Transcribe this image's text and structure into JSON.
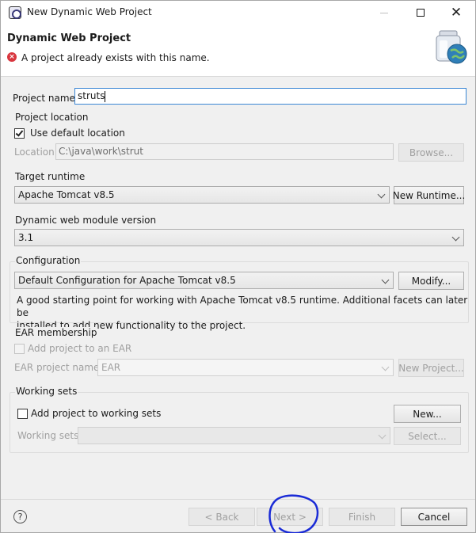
{
  "window": {
    "title": "New Dynamic Web Project",
    "minimize_icon": "minimize-icon",
    "maximize_icon": "maximize-icon",
    "close_glyph": "✕"
  },
  "banner": {
    "title": "Dynamic Web Project",
    "message": "A project already exists with this name.",
    "error_glyph": "×"
  },
  "project": {
    "name_label": "Project name:",
    "name_value": "struts"
  },
  "location": {
    "group_title": "Project location",
    "use_default_label": "Use default location",
    "use_default_checked": true,
    "location_label": "Location:",
    "location_value": "C:\\java\\work\\strut",
    "browse_label": "Browse..."
  },
  "runtime": {
    "group_title": "Target runtime",
    "selected": "Apache Tomcat v8.5",
    "new_runtime_label": "New Runtime..."
  },
  "module": {
    "group_title": "Dynamic web module version",
    "selected": "3.1"
  },
  "configuration": {
    "group_title": "Configuration",
    "selected": "Default Configuration for Apache Tomcat v8.5",
    "modify_label": "Modify...",
    "description_line1": "A good starting point for working with Apache Tomcat v8.5 runtime. Additional facets can later be",
    "description_line2": "installed to add new functionality to the project."
  },
  "ear": {
    "group_title": "EAR membership",
    "add_label": "Add project to an EAR",
    "project_name_label": "EAR project name:",
    "project_name_value": "EAR",
    "new_project_label": "New Project..."
  },
  "working_sets": {
    "group_title": "Working sets",
    "add_label": "Add project to working sets",
    "new_label": "New...",
    "sets_label": "Working sets:",
    "select_label": "Select..."
  },
  "footer": {
    "help_glyph": "?",
    "back_label": "< Back",
    "next_label": "Next >",
    "finish_label": "Finish",
    "cancel_label": "Cancel"
  },
  "colors": {
    "accent": "#3b86d4",
    "error": "#d9363e",
    "annotation": "#1a2bd6"
  }
}
